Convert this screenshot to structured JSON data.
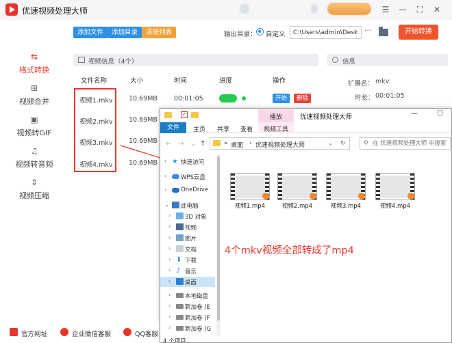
{
  "app": {
    "title": "优速视频处理大师"
  },
  "window_controls": {
    "menu": "☰",
    "minimize": "—",
    "fullscreen": "⛶",
    "close": "✕"
  },
  "sidebar": {
    "items": [
      {
        "label": "格式转换",
        "icon": "format-convert-icon",
        "active": true
      },
      {
        "label": "视频合并",
        "icon": "merge-icon"
      },
      {
        "label": "视频转GIF",
        "icon": "gif-icon"
      },
      {
        "label": "视频转音频",
        "icon": "audio-icon"
      },
      {
        "label": "视频压缩",
        "icon": "compress-icon"
      }
    ]
  },
  "toolbar": {
    "add_file": "添加文件",
    "add_folder": "添加目录",
    "clear_list": "清除列表",
    "output_label": "输出目录：",
    "custom_label": "自定义",
    "output_path": "C:\\Users\\admin\\Deskto",
    "more": "···",
    "start": "开始转换"
  },
  "file_panel": {
    "title": "视频信息（4个）",
    "columns": [
      "文件名称",
      "大小",
      "时间",
      "进度",
      "操作"
    ],
    "rows": [
      {
        "name": "视频1.mkv",
        "size": "10.69MB",
        "time": "00:01:05",
        "start": "开始",
        "delete": "删除"
      },
      {
        "name": "视频2.mkv",
        "size": "10.69MB",
        "time": "00:01:05"
      },
      {
        "name": "视频3.mkv",
        "size": "10.69MB",
        "time": "00:01:05"
      },
      {
        "name": "视频4.mkv",
        "size": "10.69MB",
        "time": "00:01:05"
      }
    ]
  },
  "info_panel": {
    "title": "信息",
    "ext_label": "扩展名：",
    "ext_value": "mkv",
    "duration_label": "时长：",
    "duration_value": "00:01:05"
  },
  "explorer": {
    "title": "优速视频处理大师",
    "play_tab": "播放",
    "ribbon": {
      "file": "文件",
      "home": "主页",
      "share": "共享",
      "view": "查看",
      "video_tools": "视频工具"
    },
    "address": {
      "prefix": "«",
      "part1": "桌面",
      "sep": "›",
      "part2": "优速视频处理大师"
    },
    "search_placeholder": "在 优速视频处理大师 中搜索",
    "tree": [
      {
        "label": "快速访问",
        "icon": "star-icon"
      },
      {
        "label": "WPS云盘",
        "icon": "cloud-icon"
      },
      {
        "label": "OneDrive",
        "icon": "onedrive-icon"
      },
      {
        "label": "此电脑",
        "icon": "computer-icon"
      },
      {
        "label": "3D 对象",
        "icon": "cube-icon"
      },
      {
        "label": "视频",
        "icon": "video-folder-icon"
      },
      {
        "label": "图片",
        "icon": "picture-folder-icon"
      },
      {
        "label": "文档",
        "icon": "document-folder-icon"
      },
      {
        "label": "下载",
        "icon": "download-folder-icon"
      },
      {
        "label": "音乐",
        "icon": "music-folder-icon"
      },
      {
        "label": "桌面",
        "icon": "desktop-folder-icon",
        "selected": true
      },
      {
        "label": "本地磁盘",
        "icon": "drive-icon"
      },
      {
        "label": "新加卷 (E",
        "icon": "drive-icon"
      },
      {
        "label": "新加卷 (F",
        "icon": "drive-icon"
      },
      {
        "label": "新加卷 (G",
        "icon": "drive-icon"
      }
    ],
    "files": [
      "视频1.mp4",
      "视频2.mp4",
      "视频3.mp4",
      "视频4.mp4"
    ],
    "status": "4 个项目"
  },
  "annotation": "4个mkv视频全部转成了mp4",
  "bottom": {
    "website": "官方网址",
    "wechat": "企业微信客服",
    "qq": "QQ客服"
  },
  "colors": {
    "accent": "#e8352b",
    "blue": "#2d8fe5",
    "orange": "#f0a23a",
    "start_button": "#f0542c",
    "progress": "#28c850"
  }
}
